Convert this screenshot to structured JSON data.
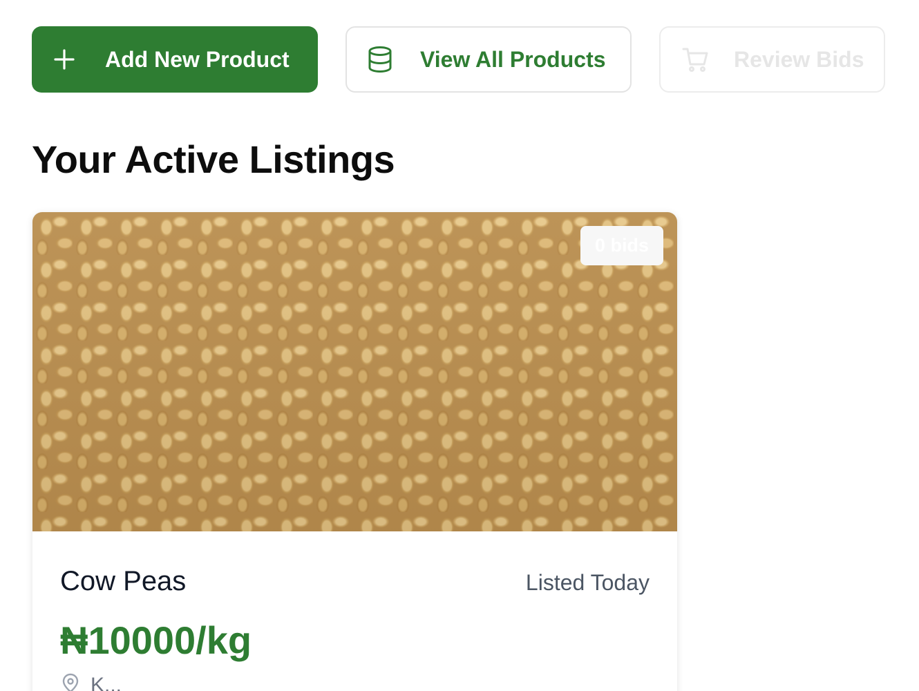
{
  "actions": {
    "add_new_product": "Add New Product",
    "view_all_products": "View All Products",
    "review_bids": "Review Bids"
  },
  "icons": {
    "add": "plus-icon",
    "view_all": "database-icon",
    "review_bids": "cart-icon",
    "location": "map-pin-icon"
  },
  "colors": {
    "brand_green": "#2e7d32",
    "disabled_text": "#e6e6e6"
  },
  "listings": {
    "title": "Your Active Listings",
    "items": [
      {
        "bids": "0 bids",
        "name": "Cow Peas",
        "listed": "Listed Today",
        "price": "₦10000/kg",
        "location": "K..."
      }
    ]
  }
}
